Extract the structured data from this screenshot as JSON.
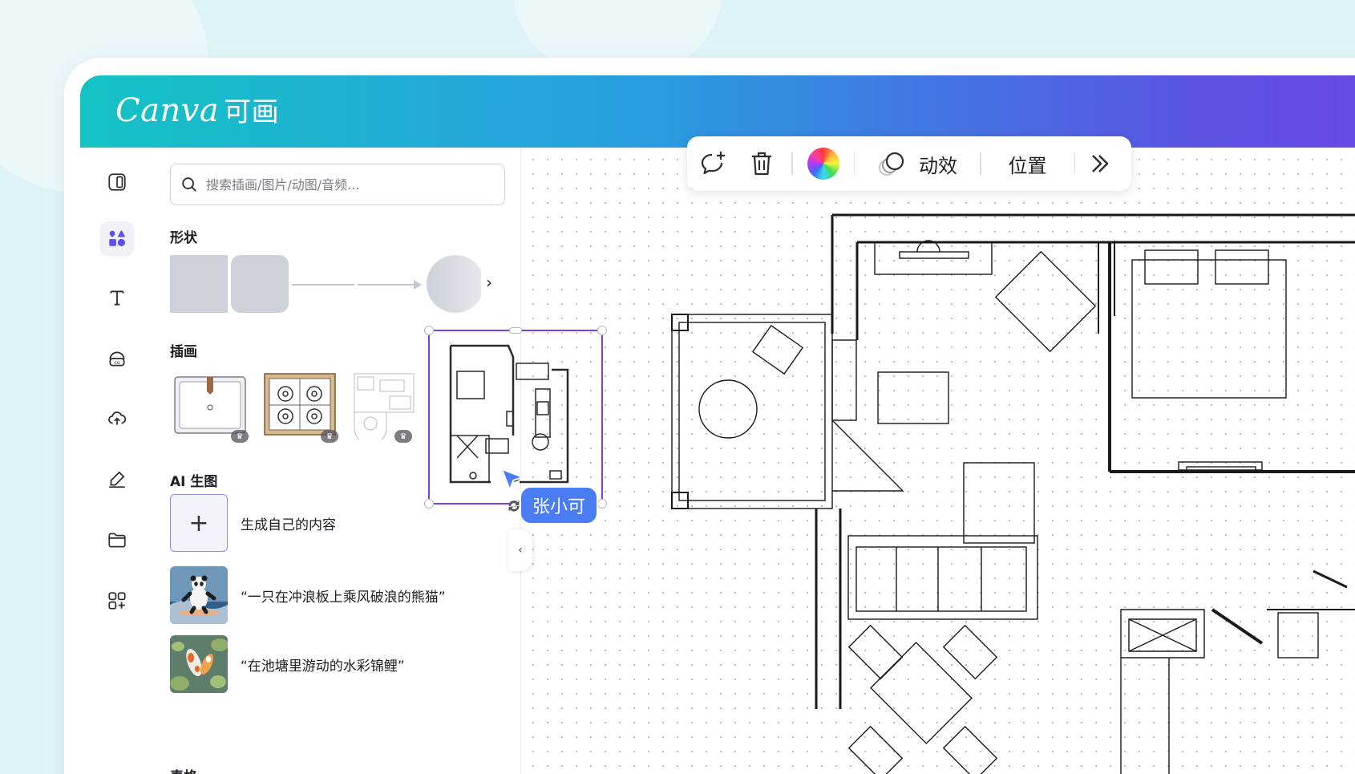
{
  "app": {
    "logo_text": "Canva",
    "logo_cn": "可画",
    "brand_gradient": [
      "#14c3c4",
      "#2a9be0",
      "#6b47e6"
    ]
  },
  "rail": {
    "items": [
      {
        "name": "design",
        "icon": "layout-icon"
      },
      {
        "name": "elements",
        "icon": "shapes-icon",
        "active": true
      },
      {
        "name": "text",
        "icon": "text-icon"
      },
      {
        "name": "brand",
        "icon": "brand-icon"
      },
      {
        "name": "uploads",
        "icon": "cloud-upload-icon"
      },
      {
        "name": "draw",
        "icon": "pen-icon"
      },
      {
        "name": "projects",
        "icon": "folder-icon"
      },
      {
        "name": "apps",
        "icon": "apps-icon"
      }
    ]
  },
  "panel": {
    "search_placeholder": "搜索插画/图片/动图/音频...",
    "shapes_title": "形状",
    "illustrations_title": "插画",
    "ai_title": "AI 生图",
    "ai_items": [
      {
        "label": "生成自己的内容"
      },
      {
        "label": "“一只在冲浪板上乘风破浪的熊猫”"
      },
      {
        "label": "“在池塘里游动的水彩锦鲤”"
      }
    ],
    "table_title": "表格"
  },
  "toolbar": {
    "animate_label": "动效",
    "position_label": "位置"
  },
  "collaborator": {
    "name": "张小可",
    "color": "#4a7cf4"
  },
  "selection_color": "#7b3fe4"
}
